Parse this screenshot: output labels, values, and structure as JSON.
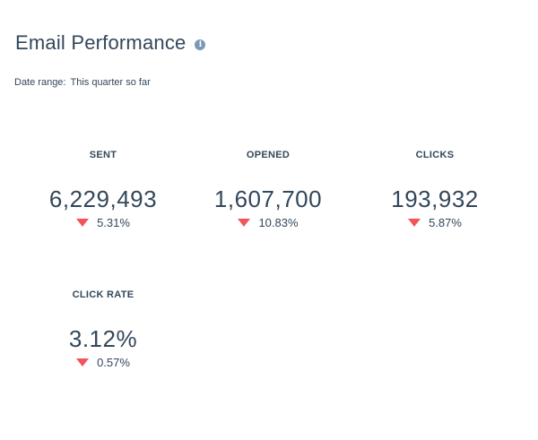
{
  "header": {
    "title": "Email Performance",
    "info_icon": "info-icon"
  },
  "date_range": {
    "label": "Date range:",
    "value": "This quarter so far"
  },
  "metrics": [
    {
      "label": "SENT",
      "value": "6,229,493",
      "change": "5.31%",
      "trend": "down"
    },
    {
      "label": "OPENED",
      "value": "1,607,700",
      "change": "10.83%",
      "trend": "down"
    },
    {
      "label": "CLICKS",
      "value": "193,932",
      "change": "5.87%",
      "trend": "down"
    },
    {
      "label": "CLICK RATE",
      "value": "3.12%",
      "change": "0.57%",
      "trend": "down"
    }
  ],
  "colors": {
    "text": "#33475b",
    "down": "#f2545b",
    "info_icon": "#7c98b6"
  }
}
